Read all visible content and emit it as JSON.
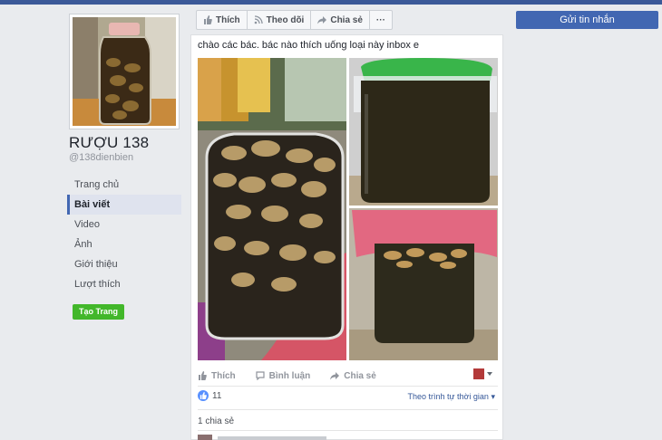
{
  "page": {
    "name": "RƯỢU 138",
    "handle": "@138dienbien"
  },
  "nav": {
    "items": [
      {
        "label": "Trang chủ"
      },
      {
        "label": "Bài viết"
      },
      {
        "label": "Video"
      },
      {
        "label": "Ảnh"
      },
      {
        "label": "Giới thiệu"
      },
      {
        "label": "Lượt thích"
      }
    ],
    "active_index": 1,
    "create_page_label": "Tạo Trang"
  },
  "actionbar": {
    "like_label": "Thích",
    "follow_label": "Theo dõi",
    "share_label": "Chia sẻ",
    "more_label": "···"
  },
  "message_button_label": "Gửi tin nhắn",
  "post": {
    "text": "chào các bác. bác nào thích uống loại này inbox e",
    "actions": {
      "like": "Thích",
      "comment": "Bình luận",
      "share": "Chia sẻ"
    },
    "like_count": "11",
    "sort_label": "Theo trình tự thời gian",
    "shares_label": "1 chia sẻ"
  },
  "colors": {
    "brand": "#3b5998",
    "primary_button": "#4267b2",
    "create_page_green": "#42b72a",
    "background": "#e9ebee"
  }
}
